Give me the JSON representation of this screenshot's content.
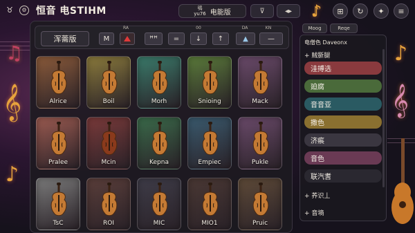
{
  "app": {
    "title": "恒音 电STIHM",
    "icon": "app-icon"
  },
  "top_center": {
    "small_top": "鸮",
    "small_bottom": "yu76",
    "label": "电能版"
  },
  "top_buttons": [
    "⊽",
    "◂▸"
  ],
  "round_buttons": [
    "♪",
    "⊞",
    "↻",
    "✦",
    "≡"
  ],
  "toolbar": {
    "preset": "浑薷版",
    "tools": [
      {
        "label": "M",
        "caption": ""
      },
      {
        "label": "",
        "caption": "RA"
      },
      {
        "label": "ꟸꟸ",
        "caption": ""
      },
      {
        "label": "=",
        "caption": ""
      },
      {
        "label": "↓",
        "caption": "00"
      },
      {
        "label": "↑",
        "caption": ""
      },
      {
        "label": "▲",
        "caption": "DA"
      },
      {
        "label": "—",
        "caption": "KN"
      }
    ]
  },
  "instruments": [
    {
      "name": "Alrice",
      "color": "#8a5a3a"
    },
    {
      "name": "Boil",
      "color": "#8a7a3c"
    },
    {
      "name": "Morh",
      "color": "#3a7a6a"
    },
    {
      "name": "Snioing",
      "color": "#5a7a3a"
    },
    {
      "name": "Mack",
      "color": "#6a4a6a"
    },
    {
      "name": "Pralee",
      "color": "#9a5a50"
    },
    {
      "name": "Mcin",
      "color": "#7a3a3a"
    },
    {
      "name": "Kepna",
      "color": "#3a6a4a"
    },
    {
      "name": "Empiec",
      "color": "#3a5a6e"
    },
    {
      "name": "Pukle",
      "color": "#6a4a6a"
    },
    {
      "name": "TsC",
      "color": "#7a7a7a"
    },
    {
      "name": "ROI",
      "color": "#5a3e3a"
    },
    {
      "name": "MIC",
      "color": "#3e3c48"
    },
    {
      "name": "MIO1",
      "color": "#4a3834"
    },
    {
      "name": "Pruic",
      "color": "#5e4a38"
    }
  ],
  "right_tabs": [
    "Moog",
    "Reqe"
  ],
  "right_panel": {
    "title": "电僧色 Daveonx",
    "section1": "+ 贼斵腿",
    "rows": [
      {
        "label": "洼搏选",
        "color": "#8a3a3e"
      },
      {
        "label": "廹腐",
        "color": "#4a6a3a"
      },
      {
        "label": "音音亚",
        "color": "#2a5a62"
      },
      {
        "label": "撒色",
        "color": "#8a7030"
      },
      {
        "label": "济痮",
        "color": "#3a3640"
      },
      {
        "label": "音色",
        "color": "#6a3a54"
      },
      {
        "label": "联汽耆",
        "color": "#2a2830"
      }
    ],
    "section2": "+ 荞识丄",
    "section3": "+ 音墒"
  },
  "colors": {
    "accent_red": "#e03a3a",
    "note_gold": "#e6a23c"
  }
}
